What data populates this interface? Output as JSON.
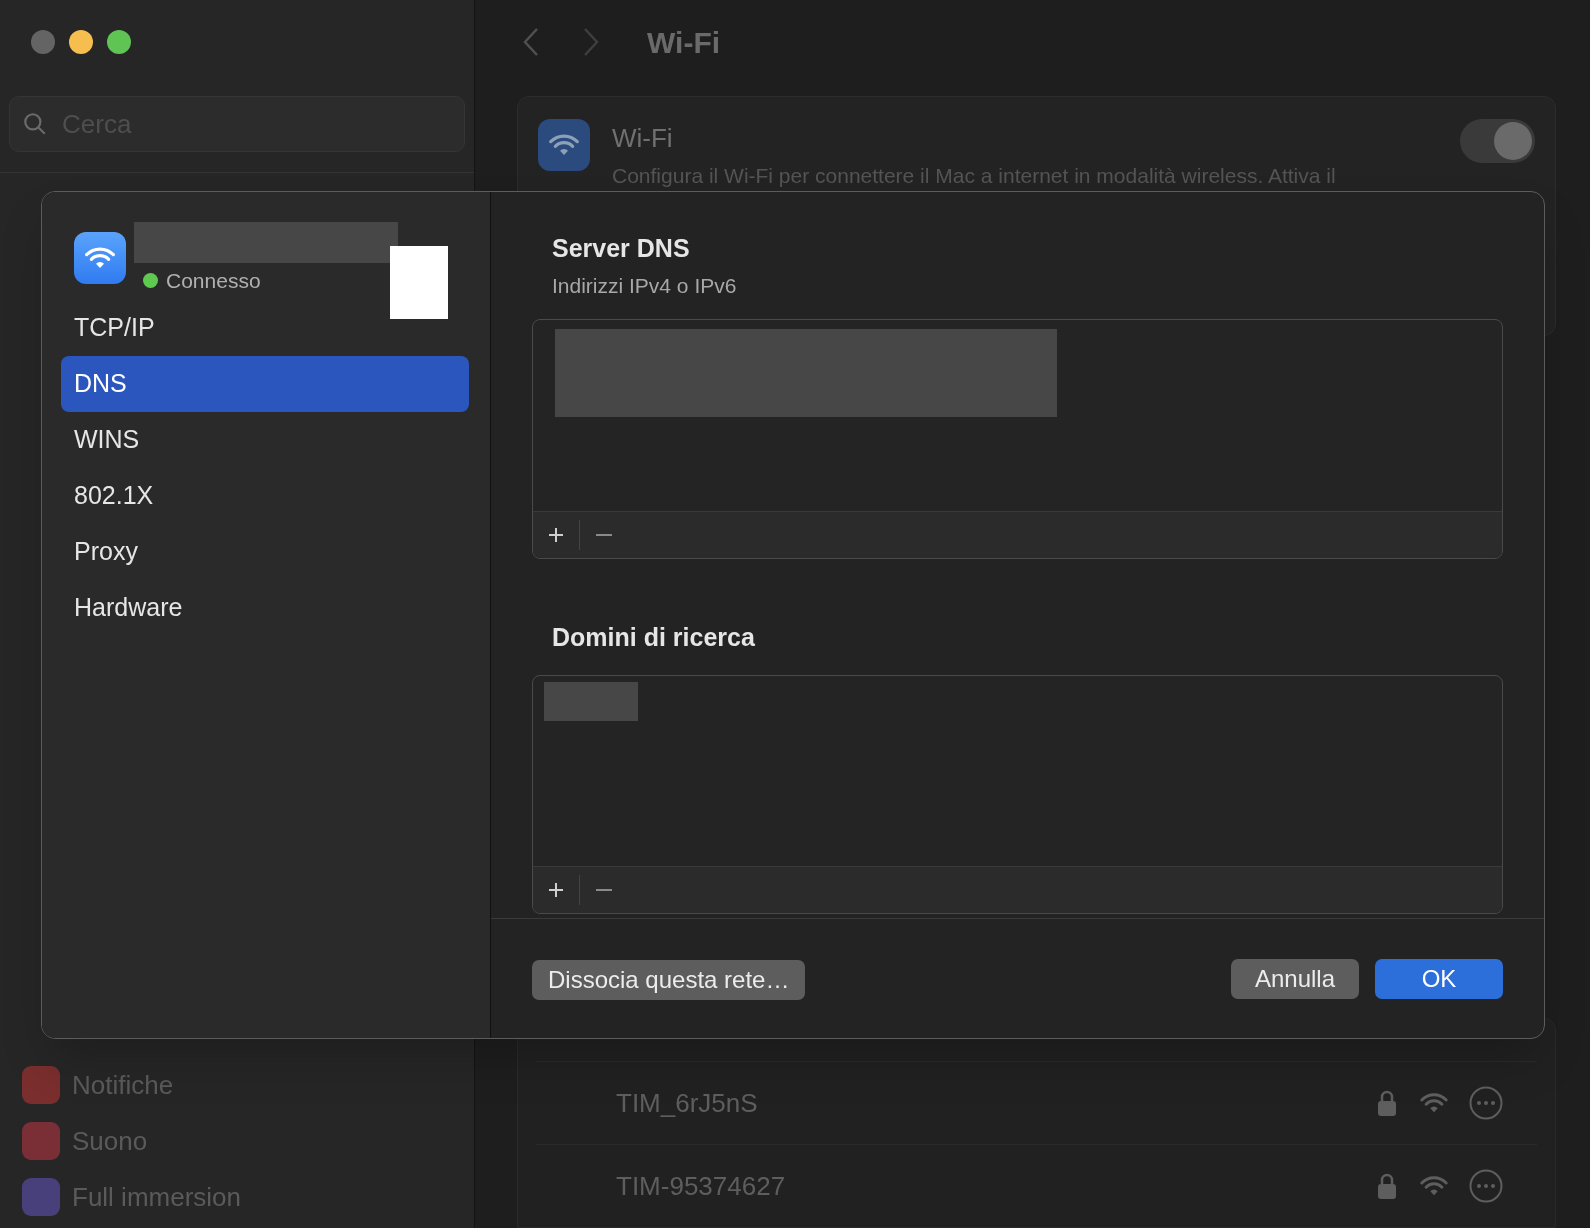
{
  "sidebar": {
    "search": {
      "placeholder": "Cerca"
    },
    "items": [
      {
        "label": "Notifiche",
        "color": "#7a2e2e"
      },
      {
        "label": "Suono",
        "color": "#7a2e36"
      },
      {
        "label": "Full immersion",
        "color": "#47407a"
      }
    ]
  },
  "header": {
    "title": "Wi-Fi"
  },
  "wifi_card": {
    "title": "Wi-Fi",
    "description": "Configura il Wi-Fi per connettere il Mac a internet in modalità wireless. Attiva il",
    "on": true
  },
  "networks": [
    {
      "name": "TIM_6rJ5nS",
      "locked": true
    },
    {
      "name": "TIM-95374627",
      "locked": true
    }
  ],
  "dialog": {
    "network": {
      "status": "Connesso",
      "connected": true
    },
    "tabs": [
      {
        "label": "TCP/IP",
        "selected": false
      },
      {
        "label": "DNS",
        "selected": true
      },
      {
        "label": "WINS",
        "selected": false
      },
      {
        "label": "802.1X",
        "selected": false
      },
      {
        "label": "Proxy",
        "selected": false
      },
      {
        "label": "Hardware",
        "selected": false
      }
    ],
    "dns": {
      "title": "Server DNS",
      "subtitle": "Indirizzi IPv4 o IPv6"
    },
    "search_domains": {
      "title": "Domini di ricerca"
    },
    "buttons": {
      "dissociate": "Dissocia questa rete…",
      "cancel": "Annulla",
      "ok": "OK"
    }
  }
}
